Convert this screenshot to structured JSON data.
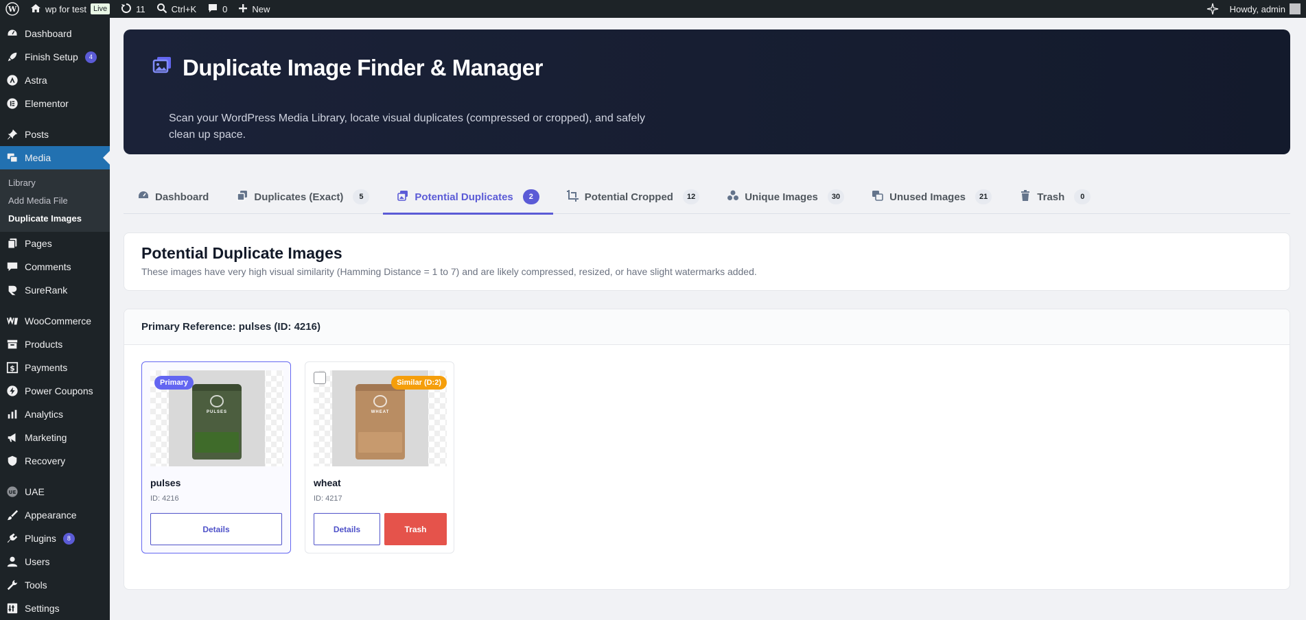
{
  "admin_bar": {
    "site_name": "wp for test",
    "live_label": "Live",
    "updates_count": "11",
    "search_shortcut": "Ctrl+K",
    "comments_count": "0",
    "new_label": "New",
    "howdy": "Howdy, admin"
  },
  "sidebar": {
    "items": [
      {
        "label": "Dashboard",
        "icon": "dashboard-icon"
      },
      {
        "label": "Finish Setup",
        "icon": "rocket-icon",
        "badge": "4"
      },
      {
        "label": "Astra",
        "icon": "astra-icon"
      },
      {
        "label": "Elementor",
        "icon": "elementor-icon"
      },
      {
        "label": "Posts",
        "icon": "pushpin-icon"
      },
      {
        "label": "Media",
        "icon": "media-icon"
      },
      {
        "label": "Pages",
        "icon": "pages-icon"
      },
      {
        "label": "Comments",
        "icon": "comment-icon"
      },
      {
        "label": "SureRank",
        "icon": "surerank-icon"
      },
      {
        "label": "WooCommerce",
        "icon": "woocommerce-icon"
      },
      {
        "label": "Products",
        "icon": "archive-icon"
      },
      {
        "label": "Payments",
        "icon": "dollar-icon"
      },
      {
        "label": "Power Coupons",
        "icon": "power-icon"
      },
      {
        "label": "Analytics",
        "icon": "bar-chart-icon"
      },
      {
        "label": "Marketing",
        "icon": "megaphone-icon"
      },
      {
        "label": "Recovery",
        "icon": "shield-icon"
      },
      {
        "label": "UAE",
        "icon": "uae-icon"
      },
      {
        "label": "Appearance",
        "icon": "paintbrush-icon"
      },
      {
        "label": "Plugins",
        "icon": "plug-icon",
        "badge": "8"
      },
      {
        "label": "Users",
        "icon": "user-icon"
      },
      {
        "label": "Tools",
        "icon": "wrench-icon"
      },
      {
        "label": "Settings",
        "icon": "settings-icon"
      }
    ],
    "media_submenu": [
      "Library",
      "Add Media File",
      "Duplicate Images"
    ]
  },
  "hero": {
    "title": "Duplicate Image Finder & Manager",
    "description": "Scan your WordPress Media Library, locate visual duplicates (compressed or cropped), and safely clean up space."
  },
  "tabs": [
    {
      "label": "Dashboard",
      "count": null
    },
    {
      "label": "Duplicates (Exact)",
      "count": "5"
    },
    {
      "label": "Potential Duplicates",
      "count": "2"
    },
    {
      "label": "Potential Cropped",
      "count": "12"
    },
    {
      "label": "Unique Images",
      "count": "30"
    },
    {
      "label": "Unused Images",
      "count": "21"
    },
    {
      "label": "Trash",
      "count": "0"
    }
  ],
  "section": {
    "title": "Potential Duplicate Images",
    "description": "These images have very high visual similarity (Hamming Distance = 1 to 7) and are likely compressed, resized, or have slight watermarks added."
  },
  "group": {
    "header": "Primary Reference: pulses (ID: 4216)",
    "images": [
      {
        "name": "pulses",
        "id_text": "ID: 4216",
        "badge": "Primary",
        "bag_label": "PULSES",
        "details_label": "Details"
      },
      {
        "name": "wheat",
        "id_text": "ID: 4217",
        "badge": "Similar (D:2)",
        "bag_label": "WHEAT",
        "details_label": "Details",
        "trash_label": "Trash"
      }
    ]
  },
  "colors": {
    "accent": "#5b5bd6",
    "primary_badge": "#6366f1",
    "similar_badge": "#f59e0b",
    "trash_button": "#e5534b",
    "pulses_bag": "#4c5e3f",
    "wheat_bag": "#b98d63"
  }
}
